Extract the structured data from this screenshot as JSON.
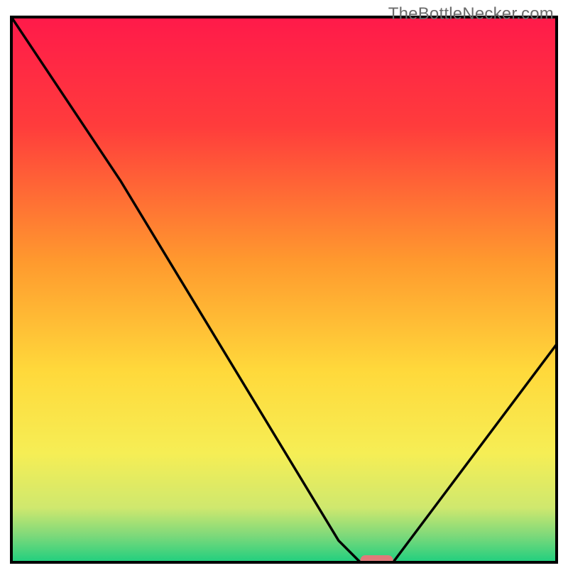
{
  "attribution": "TheBottleNecker.com",
  "chart_data": {
    "type": "line",
    "title": "",
    "xlabel": "",
    "ylabel": "",
    "xlim": [
      0,
      100
    ],
    "ylim": [
      0,
      100
    ],
    "gradient_stops": [
      {
        "offset": 0,
        "color": "#ff1a4a"
      },
      {
        "offset": 20,
        "color": "#ff3c3c"
      },
      {
        "offset": 45,
        "color": "#ff9a2e"
      },
      {
        "offset": 65,
        "color": "#ffd93b"
      },
      {
        "offset": 80,
        "color": "#f6ee55"
      },
      {
        "offset": 90,
        "color": "#cfe86e"
      },
      {
        "offset": 95,
        "color": "#7fd97a"
      },
      {
        "offset": 100,
        "color": "#1fcf7f"
      }
    ],
    "curve": {
      "comment": "V-shaped bottleneck curve; y = bottleneck percentage (100=bad red, 0=good green) vs x = component balance position",
      "points": [
        {
          "x": 0,
          "y": 100
        },
        {
          "x": 20,
          "y": 70
        },
        {
          "x": 60,
          "y": 4
        },
        {
          "x": 64,
          "y": 0
        },
        {
          "x": 70,
          "y": 0
        },
        {
          "x": 100,
          "y": 40
        }
      ]
    },
    "optimal_marker": {
      "x_from": 64,
      "x_to": 70,
      "y": 0,
      "color": "#e07a7a"
    },
    "frame": {
      "x": 2,
      "y": 3,
      "w": 96,
      "h": 96,
      "stroke": "#000000",
      "stroke_width": 2
    }
  }
}
